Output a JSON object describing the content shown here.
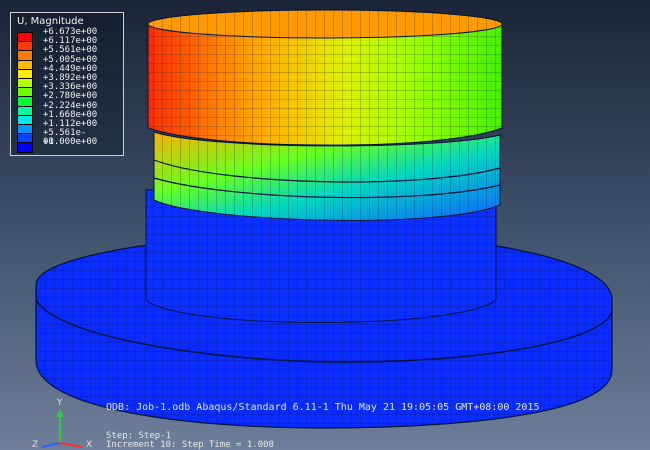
{
  "legend": {
    "title": "U, Magnitude",
    "entries": [
      {
        "label": "+6.673e+00",
        "color": "#ff0000"
      },
      {
        "label": "+6.117e+00",
        "color": "#ff3a00"
      },
      {
        "label": "+5.561e+00",
        "color": "#ff7a00"
      },
      {
        "label": "+5.005e+00",
        "color": "#ffb800"
      },
      {
        "label": "+4.449e+00",
        "color": "#ffee00"
      },
      {
        "label": "+3.892e+00",
        "color": "#b8ff00"
      },
      {
        "label": "+3.336e+00",
        "color": "#6cff00"
      },
      {
        "label": "+2.780e+00",
        "color": "#00ff30"
      },
      {
        "label": "+2.224e+00",
        "color": "#00ff9a"
      },
      {
        "label": "+1.668e+00",
        "color": "#00e8e8"
      },
      {
        "label": "+1.112e+00",
        "color": "#0094ff"
      },
      {
        "label": "+5.561e-01",
        "color": "#0044ff"
      },
      {
        "label": "+0.000e+00",
        "color": "#0000ff"
      }
    ]
  },
  "info_line": "ODB: Job-1.odb    Abaqus/Standard 6.11-1    Thu May 21 19:05:05 GMT+08:00 2015",
  "step_line1": "Step: Step-1",
  "step_line2": "Increment   10: Step Time =   1.000",
  "axes": {
    "y": "Y",
    "z": "Z",
    "x": "X"
  },
  "colors": {
    "mesh_blue": "#0a2cff",
    "edge_dark": "#00133a"
  }
}
